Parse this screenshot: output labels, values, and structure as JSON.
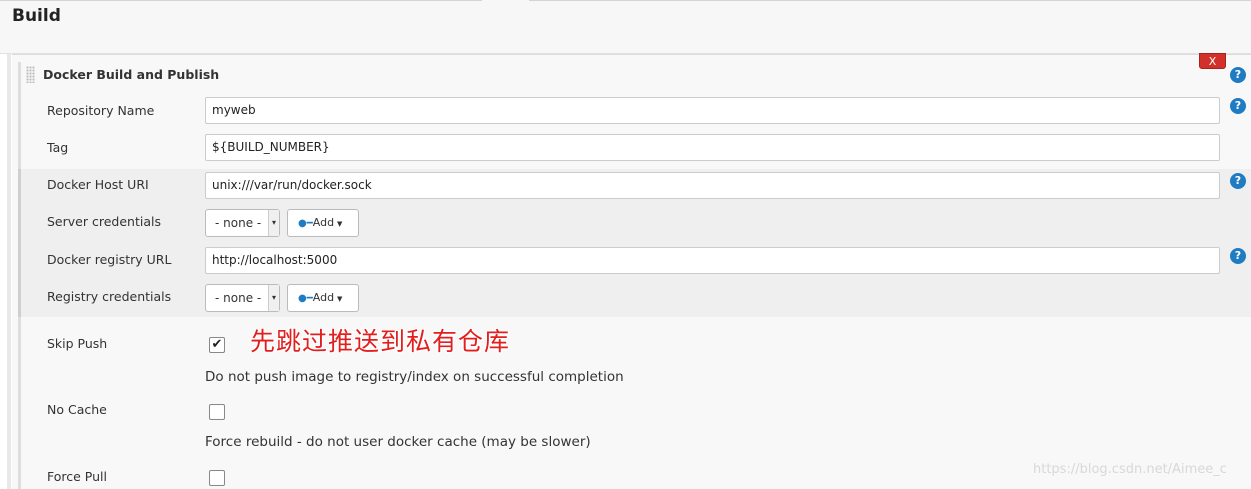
{
  "section": {
    "title": "Build"
  },
  "step": {
    "title": "Docker Build and Publish",
    "delete_label": "X"
  },
  "help_label": "?",
  "fields": {
    "repository_name": {
      "label": "Repository Name",
      "value": "myweb"
    },
    "tag": {
      "label": "Tag",
      "value": "${BUILD_NUMBER}"
    },
    "docker_host_uri": {
      "label": "Docker Host URI",
      "value": "unix:///var/run/docker.sock"
    },
    "server_credentials": {
      "label": "Server credentials",
      "selected": "- none -",
      "add_label": "Add"
    },
    "docker_registry_url": {
      "label": "Docker registry URL",
      "value": "http://localhost:5000"
    },
    "registry_credentials": {
      "label": "Registry credentials",
      "selected": "- none -",
      "add_label": "Add"
    },
    "skip_push": {
      "label": "Skip Push",
      "checked": true,
      "description": "Do not push image to registry/index on successful completion"
    },
    "no_cache": {
      "label": "No Cache",
      "checked": false,
      "description": "Force rebuild - do not user docker cache (may be slower)"
    },
    "force_pull": {
      "label": "Force Pull",
      "checked": false
    }
  },
  "annotation": "先跳过推送到私有仓库",
  "watermark": "https://blog.csdn.net/Aimee_c",
  "colors": {
    "delete": "#d2312b",
    "help": "#1f7bc2",
    "annotation": "#e21e1e"
  }
}
